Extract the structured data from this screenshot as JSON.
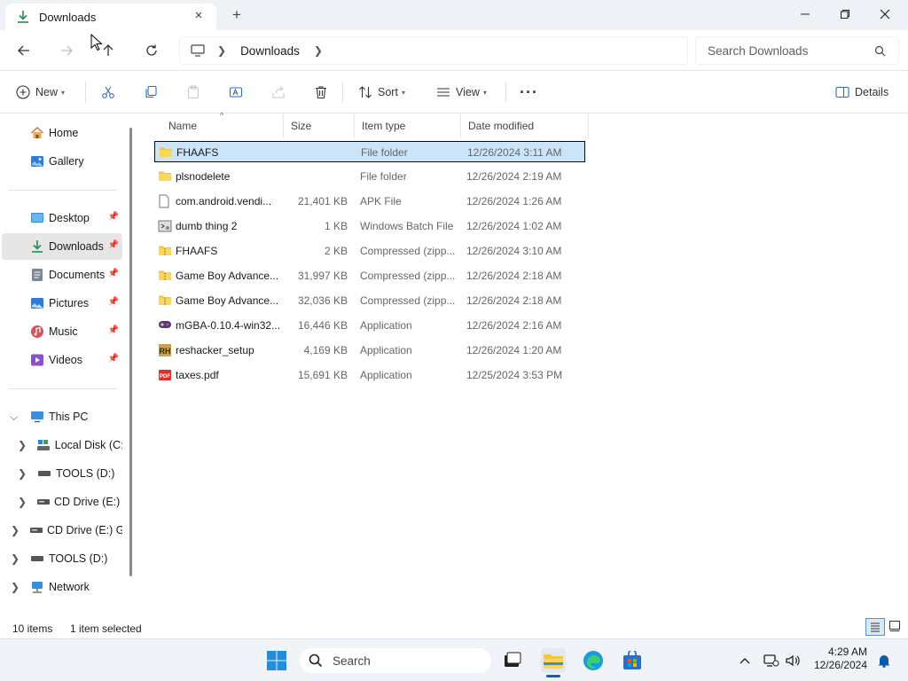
{
  "window": {
    "tab_title": "Downloads",
    "new_tab_glyph": "+",
    "close_tab_glyph": "×",
    "minimize_glyph": "—",
    "restore_glyph": "❐",
    "close_glyph": "✕"
  },
  "navbar": {
    "breadcrumb": [
      "Downloads"
    ],
    "search_placeholder": "Search Downloads"
  },
  "toolbar": {
    "new_label": "New",
    "sort_label": "Sort",
    "view_label": "View",
    "more_label": "···",
    "details_label": "Details"
  },
  "sidebar": {
    "quick": [
      {
        "label": "Home",
        "icon": "home-icon"
      },
      {
        "label": "Gallery",
        "icon": "gallery-icon"
      }
    ],
    "pinned": [
      {
        "label": "Desktop",
        "icon": "desktop-icon"
      },
      {
        "label": "Downloads",
        "icon": "downloads-icon"
      },
      {
        "label": "Documents",
        "icon": "documents-icon"
      },
      {
        "label": "Pictures",
        "icon": "pictures-icon"
      },
      {
        "label": "Music",
        "icon": "music-icon"
      },
      {
        "label": "Videos",
        "icon": "videos-icon"
      }
    ],
    "tree": [
      {
        "label": "This PC",
        "icon": "pc-icon"
      },
      {
        "label": "Local Disk (C:)",
        "icon": "local-disk-icon"
      },
      {
        "label": "TOOLS (D:)",
        "icon": "drive-icon"
      },
      {
        "label": "CD Drive (E:) G",
        "icon": "cd-drive-icon"
      },
      {
        "label": "CD Drive (E:) GP",
        "icon": "cd-drive-icon"
      },
      {
        "label": "TOOLS (D:)",
        "icon": "drive-icon"
      },
      {
        "label": "Network",
        "icon": "network-icon"
      }
    ]
  },
  "columns": {
    "name": "Name",
    "size": "Size",
    "type": "Item type",
    "date": "Date modified"
  },
  "files": [
    {
      "name": "FHAAFS",
      "size": "",
      "type": "File folder",
      "date": "12/26/2024 3:11 AM",
      "icon": "folder-icon"
    },
    {
      "name": "plsnodelete",
      "size": "",
      "type": "File folder",
      "date": "12/26/2024 2:19 AM",
      "icon": "folder-icon"
    },
    {
      "name": "com.android.vendi...",
      "size": "21,401 KB",
      "type": "APK File",
      "date": "12/26/2024 1:26 AM",
      "icon": "file-icon"
    },
    {
      "name": "dumb thing 2",
      "size": "1 KB",
      "type": "Windows Batch File",
      "date": "12/26/2024 1:02 AM",
      "icon": "batch-file-icon"
    },
    {
      "name": "FHAAFS",
      "size": "2 KB",
      "type": "Compressed (zipp...",
      "date": "12/26/2024 3:10 AM",
      "icon": "zip-folder-icon"
    },
    {
      "name": "Game Boy Advance...",
      "size": "31,997 KB",
      "type": "Compressed (zipp...",
      "date": "12/26/2024 2:18 AM",
      "icon": "zip-folder-icon"
    },
    {
      "name": "Game Boy Advance...",
      "size": "32,036 KB",
      "type": "Compressed (zipp...",
      "date": "12/26/2024 2:18 AM",
      "icon": "zip-folder-icon"
    },
    {
      "name": "mGBA-0.10.4-win32...",
      "size": "16,446 KB",
      "type": "Application",
      "date": "12/26/2024 2:16 AM",
      "icon": "mgba-app-icon"
    },
    {
      "name": "reshacker_setup",
      "size": "4,169 KB",
      "type": "Application",
      "date": "12/26/2024 1:20 AM",
      "icon": "reshacker-app-icon"
    },
    {
      "name": "taxes.pdf",
      "size": "15,691 KB",
      "type": "Application",
      "date": "12/25/2024 3:53 PM",
      "icon": "pdf-icon"
    }
  ],
  "status": {
    "count": "10 items",
    "selected": "1 item selected"
  },
  "taskbar": {
    "search_label": "Search",
    "time": "4:29 AM",
    "date": "12/26/2024"
  },
  "colors": {
    "selection": "#cce4f7",
    "folder": "#f4c542",
    "accent": "#0067c0"
  }
}
